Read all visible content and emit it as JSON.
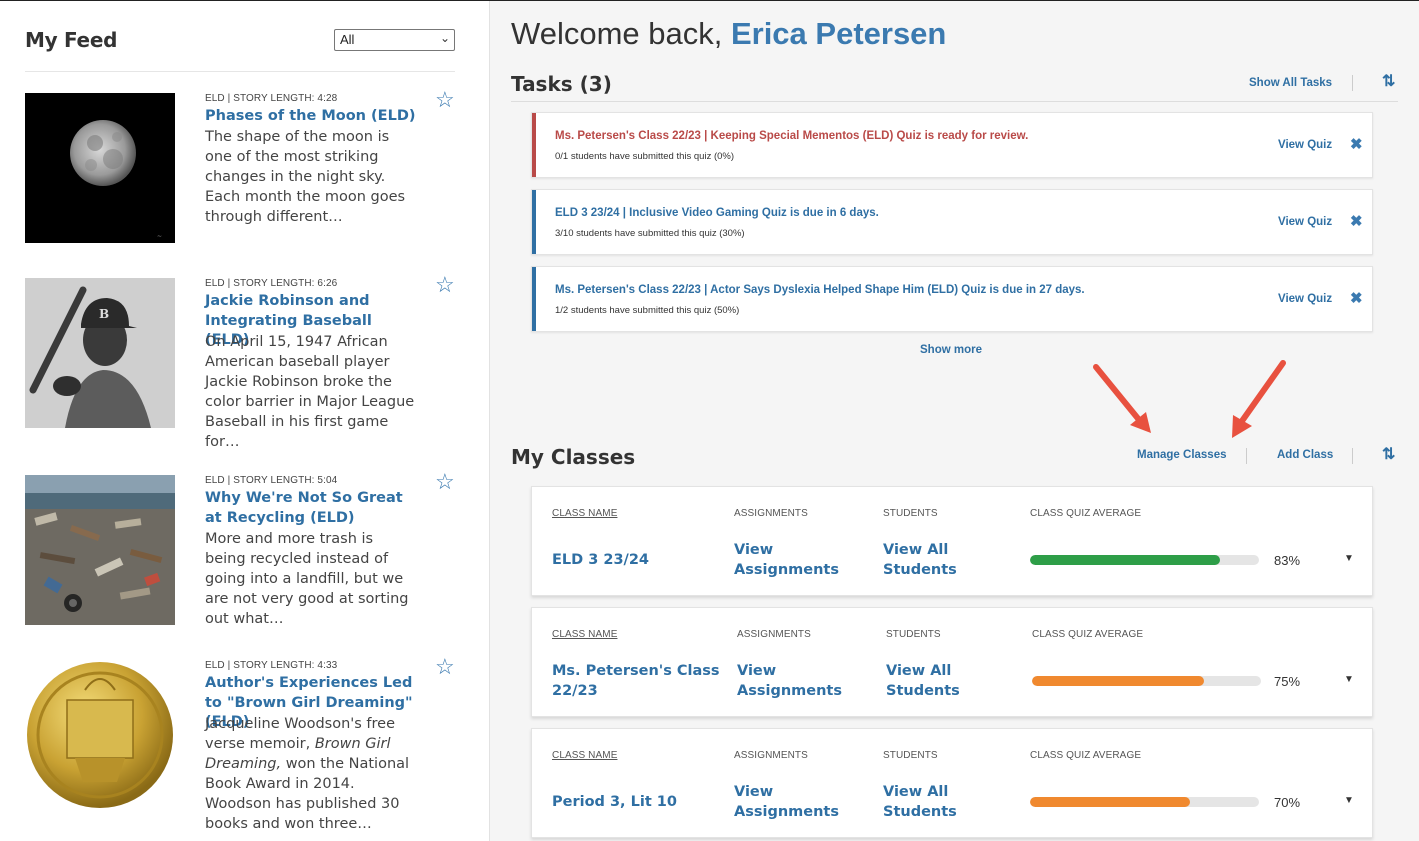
{
  "feed": {
    "title": "My Feed",
    "filter": "All",
    "stories": [
      {
        "meta": "ELD | STORY LENGTH: 4:28",
        "title": "Phases of the Moon (ELD)",
        "summary": "The shape of the moon is one of the most striking changes in the night sky. Each month the moon goes through different…"
      },
      {
        "meta": "ELD | STORY LENGTH: 6:26",
        "title": "Jackie Robinson and Integrating Baseball (ELD)",
        "summary": "On April 15, 1947 African American baseball player Jackie Robinson broke the color barrier in Major League Baseball in his first game for…"
      },
      {
        "meta": "ELD | STORY LENGTH: 5:04",
        "title": "Why We're Not So Great at Recycling (ELD)",
        "summary": "More and more trash is being recycled instead of going into a landfill, but we are not very good at sorting out what…"
      },
      {
        "meta": "ELD | STORY LENGTH: 4:33",
        "title": "Author's Experiences Led to \"Brown Girl Dreaming\" (ELD)",
        "summary_pre": "Jacqueline Woodson's free verse memoir, ",
        "summary_em": "Brown Girl Dreaming,",
        "summary_post": " won the National Book Award in 2014. Woodson has published 30 books and won three…"
      }
    ]
  },
  "welcome": {
    "prefix": "Welcome back, ",
    "name": "Erica Petersen"
  },
  "tasks": {
    "title": "Tasks (3)",
    "show_all": "Show All Tasks",
    "show_more": "Show more",
    "items": [
      {
        "title": "Ms. Petersen's Class 22/23 | Keeping Special Mementos (ELD) Quiz is ready for review.",
        "sub": "0/1 students have submitted this quiz (0%)",
        "action": "View Quiz",
        "accent": "#b94a48"
      },
      {
        "title": "ELD 3 23/24 | Inclusive Video Gaming Quiz is due in 6 days.",
        "sub": "3/10 students have submitted this quiz (30%)",
        "action": "View Quiz",
        "accent": "#2f6fa3"
      },
      {
        "title": "Ms. Petersen's Class 22/23 | Actor Says Dyslexia Helped Shape Him (ELD) Quiz is due in 27 days.",
        "sub": "1/2 students have submitted this quiz (50%)",
        "action": "View Quiz",
        "accent": "#2f6fa3"
      }
    ]
  },
  "classes": {
    "title": "My Classes",
    "manage": "Manage Classes",
    "add": "Add Class",
    "headers": {
      "name": "CLASS NAME",
      "assignments": "ASSIGNMENTS",
      "students": "STUDENTS",
      "average": "CLASS QUIZ AVERAGE"
    },
    "items": [
      {
        "name": "ELD 3 23/24",
        "assignments_l1": "View",
        "assignments_l2": "Assignments",
        "students_l1": "View All",
        "students_l2": "Students",
        "average": 83,
        "average_label": "83%",
        "color": "#2e9e48"
      },
      {
        "name_l1": "Ms. Petersen's Class",
        "name_l2": "22/23",
        "assignments_l1": "View",
        "assignments_l2": "Assignments",
        "students_l1": "View All",
        "students_l2": "Students",
        "average": 75,
        "average_label": "75%",
        "color": "#f0892f"
      },
      {
        "name": "Period 3, Lit 10",
        "assignments_l1": "View",
        "assignments_l2": "Assignments",
        "students_l1": "View All",
        "students_l2": "Students",
        "average": 70,
        "average_label": "70%",
        "color": "#f0892f"
      }
    ]
  },
  "colors": {
    "brand_blue": "#2f6fa3",
    "alert_red": "#b94a48",
    "annotation_arrow": "#e8513f"
  }
}
